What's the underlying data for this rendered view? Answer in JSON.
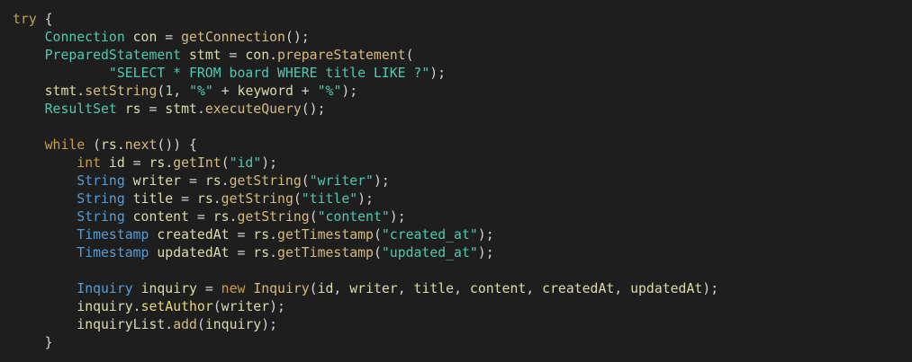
{
  "editor": {
    "language": "java",
    "background": "#1e1e1e",
    "lines": [
      [
        {
          "t": "try",
          "c": "kw"
        },
        {
          "t": " {",
          "c": "pu"
        }
      ],
      [
        {
          "t": "    ",
          "c": "pu"
        },
        {
          "t": "Connection",
          "c": "ty"
        },
        {
          "t": " con",
          "c": "va"
        },
        {
          "t": " = ",
          "c": "pu"
        },
        {
          "t": "getConnection",
          "c": "ca"
        },
        {
          "t": "();",
          "c": "pu"
        }
      ],
      [
        {
          "t": "    ",
          "c": "pu"
        },
        {
          "t": "PreparedStatement",
          "c": "ty"
        },
        {
          "t": " stmt",
          "c": "va"
        },
        {
          "t": " = ",
          "c": "pu"
        },
        {
          "t": "con",
          "c": "va"
        },
        {
          "t": ".",
          "c": "pu"
        },
        {
          "t": "prepareStatement",
          "c": "ca"
        },
        {
          "t": "(",
          "c": "pu"
        }
      ],
      [
        {
          "t": "            ",
          "c": "pu"
        },
        {
          "t": "\"SELECT * FROM board WHERE title LIKE ?\"",
          "c": "st"
        },
        {
          "t": ");",
          "c": "pu"
        }
      ],
      [
        {
          "t": "    ",
          "c": "pu"
        },
        {
          "t": "stmt",
          "c": "va"
        },
        {
          "t": ".",
          "c": "pu"
        },
        {
          "t": "setString",
          "c": "ca"
        },
        {
          "t": "(",
          "c": "pu"
        },
        {
          "t": "1",
          "c": "nu"
        },
        {
          "t": ", ",
          "c": "pu"
        },
        {
          "t": "\"%\"",
          "c": "st"
        },
        {
          "t": " + ",
          "c": "pu"
        },
        {
          "t": "keyword",
          "c": "va"
        },
        {
          "t": " + ",
          "c": "pu"
        },
        {
          "t": "\"%\"",
          "c": "st"
        },
        {
          "t": ");",
          "c": "pu"
        }
      ],
      [
        {
          "t": "    ",
          "c": "pu"
        },
        {
          "t": "ResultSet",
          "c": "ty"
        },
        {
          "t": " rs",
          "c": "va"
        },
        {
          "t": " = ",
          "c": "pu"
        },
        {
          "t": "stmt",
          "c": "va"
        },
        {
          "t": ".",
          "c": "pu"
        },
        {
          "t": "executeQuery",
          "c": "ca"
        },
        {
          "t": "();",
          "c": "pu"
        }
      ],
      [
        {
          "t": "",
          "c": "pu"
        }
      ],
      [
        {
          "t": "    ",
          "c": "pu"
        },
        {
          "t": "while",
          "c": "kw"
        },
        {
          "t": " (",
          "c": "pu"
        },
        {
          "t": "rs",
          "c": "va"
        },
        {
          "t": ".",
          "c": "pu"
        },
        {
          "t": "next",
          "c": "ca"
        },
        {
          "t": "()) {",
          "c": "pu"
        }
      ],
      [
        {
          "t": "        ",
          "c": "pu"
        },
        {
          "t": "int",
          "c": "kw"
        },
        {
          "t": " id",
          "c": "va"
        },
        {
          "t": " = ",
          "c": "pu"
        },
        {
          "t": "rs",
          "c": "va"
        },
        {
          "t": ".",
          "c": "pu"
        },
        {
          "t": "getInt",
          "c": "ca"
        },
        {
          "t": "(",
          "c": "pu"
        },
        {
          "t": "\"id\"",
          "c": "st"
        },
        {
          "t": ");",
          "c": "pu"
        }
      ],
      [
        {
          "t": "        ",
          "c": "pu"
        },
        {
          "t": "String",
          "c": "pr"
        },
        {
          "t": " writer",
          "c": "va"
        },
        {
          "t": " = ",
          "c": "pu"
        },
        {
          "t": "rs",
          "c": "va"
        },
        {
          "t": ".",
          "c": "pu"
        },
        {
          "t": "getString",
          "c": "ca"
        },
        {
          "t": "(",
          "c": "pu"
        },
        {
          "t": "\"writer\"",
          "c": "st"
        },
        {
          "t": ");",
          "c": "pu"
        }
      ],
      [
        {
          "t": "        ",
          "c": "pu"
        },
        {
          "t": "String",
          "c": "pr"
        },
        {
          "t": " title",
          "c": "va"
        },
        {
          "t": " = ",
          "c": "pu"
        },
        {
          "t": "rs",
          "c": "va"
        },
        {
          "t": ".",
          "c": "pu"
        },
        {
          "t": "getString",
          "c": "ca"
        },
        {
          "t": "(",
          "c": "pu"
        },
        {
          "t": "\"title\"",
          "c": "st"
        },
        {
          "t": ");",
          "c": "pu"
        }
      ],
      [
        {
          "t": "        ",
          "c": "pu"
        },
        {
          "t": "String",
          "c": "pr"
        },
        {
          "t": " content",
          "c": "va"
        },
        {
          "t": " = ",
          "c": "pu"
        },
        {
          "t": "rs",
          "c": "va"
        },
        {
          "t": ".",
          "c": "pu"
        },
        {
          "t": "getString",
          "c": "ca"
        },
        {
          "t": "(",
          "c": "pu"
        },
        {
          "t": "\"content\"",
          "c": "st"
        },
        {
          "t": ");",
          "c": "pu"
        }
      ],
      [
        {
          "t": "        ",
          "c": "pu"
        },
        {
          "t": "Timestamp",
          "c": "pr"
        },
        {
          "t": " createdAt",
          "c": "va"
        },
        {
          "t": " = ",
          "c": "pu"
        },
        {
          "t": "rs",
          "c": "va"
        },
        {
          "t": ".",
          "c": "pu"
        },
        {
          "t": "getTimestamp",
          "c": "ca"
        },
        {
          "t": "(",
          "c": "pu"
        },
        {
          "t": "\"created_at\"",
          "c": "st"
        },
        {
          "t": ");",
          "c": "pu"
        }
      ],
      [
        {
          "t": "        ",
          "c": "pu"
        },
        {
          "t": "Timestamp",
          "c": "pr"
        },
        {
          "t": " updatedAt",
          "c": "va"
        },
        {
          "t": " = ",
          "c": "pu"
        },
        {
          "t": "rs",
          "c": "va"
        },
        {
          "t": ".",
          "c": "pu"
        },
        {
          "t": "getTimestamp",
          "c": "ca"
        },
        {
          "t": "(",
          "c": "pu"
        },
        {
          "t": "\"updated_at\"",
          "c": "st"
        },
        {
          "t": ");",
          "c": "pu"
        }
      ],
      [
        {
          "t": "",
          "c": "pu"
        }
      ],
      [
        {
          "t": "        ",
          "c": "pu"
        },
        {
          "t": "Inquiry",
          "c": "pr"
        },
        {
          "t": " inquiry",
          "c": "va"
        },
        {
          "t": " = ",
          "c": "pu"
        },
        {
          "t": "new",
          "c": "kw"
        },
        {
          "t": " ",
          "c": "pu"
        },
        {
          "t": "Inquiry",
          "c": "ca"
        },
        {
          "t": "(",
          "c": "pu"
        },
        {
          "t": "id",
          "c": "va"
        },
        {
          "t": ", ",
          "c": "pu"
        },
        {
          "t": "writer",
          "c": "va"
        },
        {
          "t": ", ",
          "c": "pu"
        },
        {
          "t": "title",
          "c": "va"
        },
        {
          "t": ", ",
          "c": "pu"
        },
        {
          "t": "content",
          "c": "va"
        },
        {
          "t": ", ",
          "c": "pu"
        },
        {
          "t": "createdAt",
          "c": "va"
        },
        {
          "t": ", ",
          "c": "pu"
        },
        {
          "t": "updatedAt",
          "c": "va"
        },
        {
          "t": ");",
          "c": "pu"
        }
      ],
      [
        {
          "t": "        ",
          "c": "pu"
        },
        {
          "t": "inquiry",
          "c": "va"
        },
        {
          "t": ".",
          "c": "pu"
        },
        {
          "t": "setAuthor",
          "c": "fn"
        },
        {
          "t": "(",
          "c": "pu"
        },
        {
          "t": "writer",
          "c": "va"
        },
        {
          "t": ");",
          "c": "pu"
        }
      ],
      [
        {
          "t": "        ",
          "c": "pu"
        },
        {
          "t": "inquiryList",
          "c": "va"
        },
        {
          "t": ".",
          "c": "pu"
        },
        {
          "t": "add",
          "c": "ca"
        },
        {
          "t": "(",
          "c": "pu"
        },
        {
          "t": "inquiry",
          "c": "va"
        },
        {
          "t": ");",
          "c": "pu"
        }
      ],
      [
        {
          "t": "    ",
          "c": "pu"
        },
        {
          "t": "}",
          "c": "pu"
        }
      ]
    ]
  }
}
